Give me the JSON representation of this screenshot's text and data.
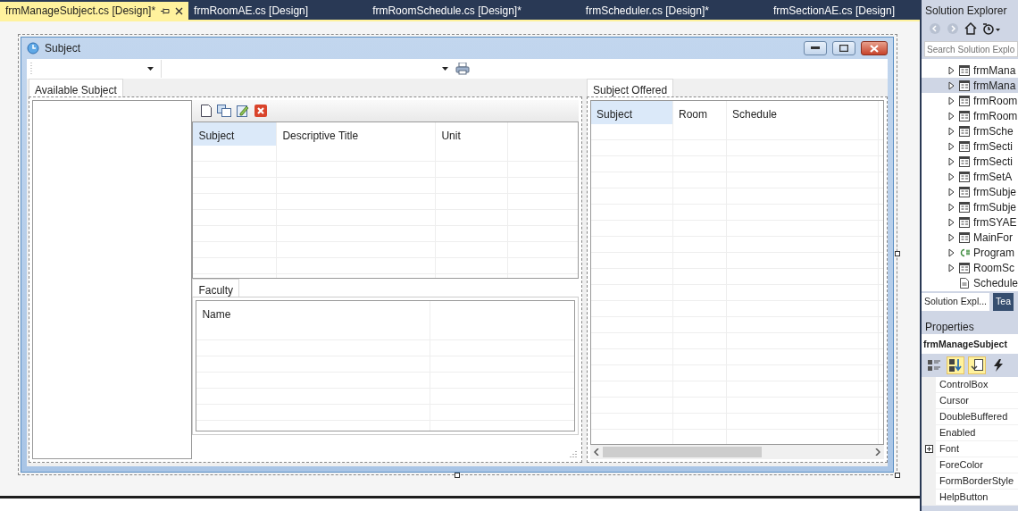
{
  "doc_tabs": [
    {
      "label": "frmManageSubject.cs [Design]*",
      "selected": true
    },
    {
      "label": "frmRoomAE.cs [Design]",
      "selected": false
    },
    {
      "label": "frmRoomSchedule.cs [Design]*",
      "selected": false
    },
    {
      "label": "frmScheduler.cs [Design]*",
      "selected": false
    },
    {
      "label": "frmSectionAE.cs [Design]",
      "selected": false
    }
  ],
  "form": {
    "title": "Subject",
    "available_tab": {
      "label": "Available Subject",
      "selected": true
    },
    "subject_grid": {
      "columns": [
        {
          "label": "Subject",
          "selected": true
        },
        {
          "label": "Descriptive Title",
          "selected": false
        },
        {
          "label": "Unit",
          "selected": false
        }
      ]
    },
    "faculty_tab": {
      "label": "Faculty",
      "selected": true
    },
    "faculty_grid": {
      "columns": [
        {
          "label": "Name",
          "selected": false
        }
      ]
    },
    "offered_tab": {
      "label": "Subject Offered",
      "selected": true
    },
    "offered_grid": {
      "columns": [
        {
          "label": "Subject",
          "selected": true
        },
        {
          "label": "Room",
          "selected": false
        },
        {
          "label": "Schedule",
          "selected": false
        }
      ]
    }
  },
  "solution_explorer": {
    "title": "Solution Explorer",
    "search": {
      "placeholder": "Search Solution Explo"
    },
    "items": [
      {
        "label": "frmMana",
        "kind": "form",
        "expandable": true,
        "selected": false
      },
      {
        "label": "frmMana",
        "kind": "form",
        "expandable": true,
        "selected": true
      },
      {
        "label": "frmRoom",
        "kind": "form",
        "expandable": true,
        "selected": false
      },
      {
        "label": "frmRoom",
        "kind": "form",
        "expandable": true,
        "selected": false
      },
      {
        "label": "frmSche",
        "kind": "form",
        "expandable": true,
        "selected": false
      },
      {
        "label": "frmSecti",
        "kind": "form",
        "expandable": true,
        "selected": false
      },
      {
        "label": "frmSecti",
        "kind": "form",
        "expandable": true,
        "selected": false
      },
      {
        "label": "frmSetA",
        "kind": "form",
        "expandable": true,
        "selected": false
      },
      {
        "label": "frmSubje",
        "kind": "form",
        "expandable": true,
        "selected": false
      },
      {
        "label": "frmSubje",
        "kind": "form",
        "expandable": true,
        "selected": false
      },
      {
        "label": "frmSYAE",
        "kind": "form",
        "expandable": true,
        "selected": false
      },
      {
        "label": "MainFor",
        "kind": "form",
        "expandable": true,
        "selected": false
      },
      {
        "label": "Program",
        "kind": "csharp",
        "expandable": true,
        "selected": false
      },
      {
        "label": "RoomSc",
        "kind": "form",
        "expandable": true,
        "selected": false
      },
      {
        "label": "Schedule",
        "kind": "file",
        "expandable": false,
        "selected": false
      }
    ],
    "tabs": [
      {
        "label": "Solution Expl...",
        "selected": true
      },
      {
        "label": "Tea",
        "selected": false
      }
    ]
  },
  "properties": {
    "title": "Properties",
    "object": "frmManageSubject",
    "rows": [
      {
        "name": "ControlBox",
        "expandable": false
      },
      {
        "name": "Cursor",
        "expandable": false
      },
      {
        "name": "DoubleBuffered",
        "expandable": false
      },
      {
        "name": "Enabled",
        "expandable": false
      },
      {
        "name": "Font",
        "expandable": true
      },
      {
        "name": "ForeColor",
        "expandable": false
      },
      {
        "name": "FormBorderStyle",
        "expandable": false
      },
      {
        "name": "HelpButton",
        "expandable": false
      }
    ]
  }
}
